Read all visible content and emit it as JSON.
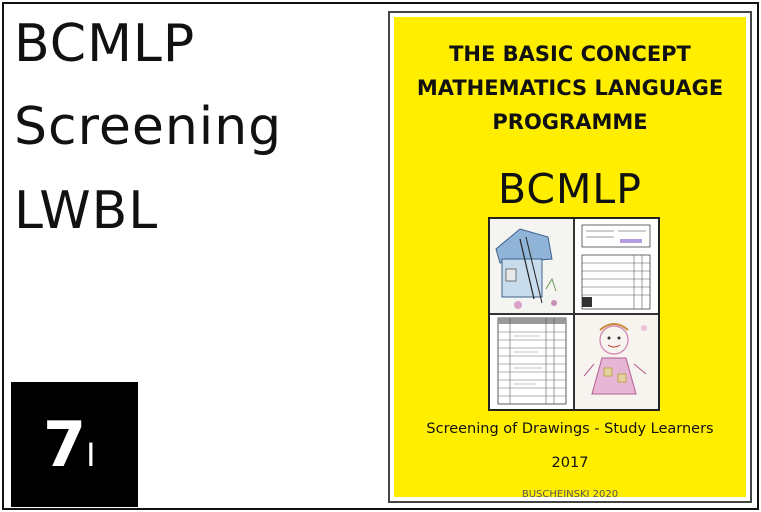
{
  "left_title": {
    "line1": "BCMLP",
    "line2": "Screening",
    "line3": "LWBL"
  },
  "badge": {
    "number": "7",
    "suffix": "I"
  },
  "cover": {
    "title_line1": "THE BASIC CONCEPT",
    "title_line2": "MATHEMATICS LANGUAGE",
    "title_line3": "PROGRAMME",
    "abbreviation": "BCMLP",
    "subtitle": "Screening of Drawings -   Study Learners",
    "year": "2017",
    "credit": "BUSCHEINSKI 2020"
  },
  "colors": {
    "cover_background": "#ffee00",
    "badge_background": "#000000",
    "text": "#111111"
  }
}
